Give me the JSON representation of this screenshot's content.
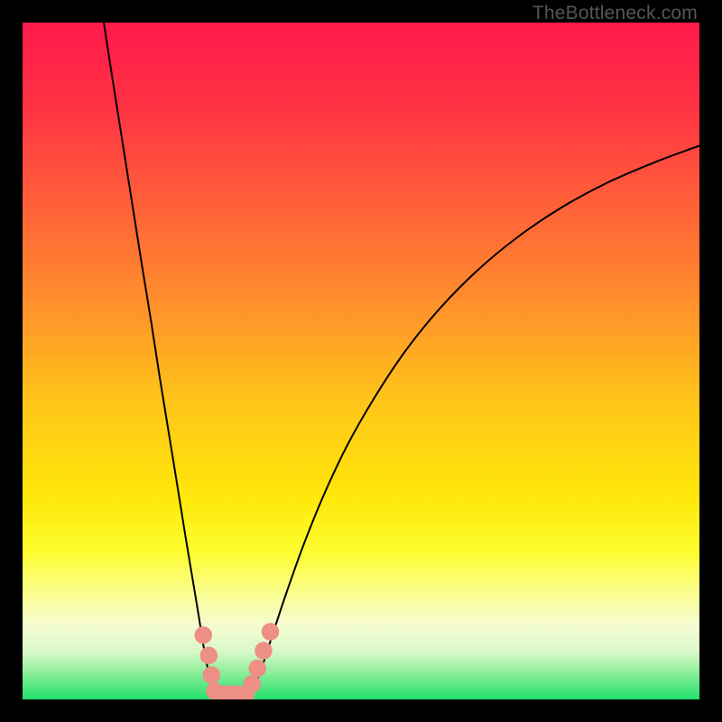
{
  "watermark": "TheBottleneck.com",
  "chart_data": {
    "type": "line",
    "title": "",
    "xlabel": "",
    "ylabel": "",
    "xlim": [
      0,
      100
    ],
    "ylim": [
      0,
      100
    ],
    "background_gradient": {
      "stops": [
        {
          "offset": 0.0,
          "color": "#ff1a4b"
        },
        {
          "offset": 0.12,
          "color": "#ff3144"
        },
        {
          "offset": 0.25,
          "color": "#ff5a3a"
        },
        {
          "offset": 0.4,
          "color": "#ff8a2d"
        },
        {
          "offset": 0.55,
          "color": "#ffc21a"
        },
        {
          "offset": 0.7,
          "color": "#ffe70a"
        },
        {
          "offset": 0.78,
          "color": "#fdfd2d"
        },
        {
          "offset": 0.84,
          "color": "#fbfd8a"
        },
        {
          "offset": 0.89,
          "color": "#f6fcd2"
        },
        {
          "offset": 0.93,
          "color": "#d8f8c8"
        },
        {
          "offset": 0.96,
          "color": "#8dee9a"
        },
        {
          "offset": 1.0,
          "color": "#22e06d"
        }
      ]
    },
    "series": [
      {
        "name": "curve",
        "stroke": "#000000",
        "stroke_width": 2,
        "points": [
          {
            "x": 12.0,
            "y": 100.0
          },
          {
            "x": 13.0,
            "y": 93.5
          },
          {
            "x": 14.5,
            "y": 84.0
          },
          {
            "x": 16.0,
            "y": 74.5
          },
          {
            "x": 17.5,
            "y": 65.0
          },
          {
            "x": 19.0,
            "y": 55.8
          },
          {
            "x": 20.2,
            "y": 48.0
          },
          {
            "x": 21.5,
            "y": 40.0
          },
          {
            "x": 22.8,
            "y": 32.0
          },
          {
            "x": 24.0,
            "y": 24.5
          },
          {
            "x": 25.0,
            "y": 18.5
          },
          {
            "x": 26.0,
            "y": 12.5
          },
          {
            "x": 26.8,
            "y": 7.5
          },
          {
            "x": 27.6,
            "y": 3.5
          },
          {
            "x": 28.4,
            "y": 1.2
          },
          {
            "x": 29.3,
            "y": 0.0
          },
          {
            "x": 30.5,
            "y": 0.0
          },
          {
            "x": 31.7,
            "y": 0.0
          },
          {
            "x": 33.0,
            "y": 0.3
          },
          {
            "x": 34.3,
            "y": 2.2
          },
          {
            "x": 35.5,
            "y": 5.2
          },
          {
            "x": 37.0,
            "y": 9.8
          },
          {
            "x": 39.0,
            "y": 15.8
          },
          {
            "x": 41.5,
            "y": 22.8
          },
          {
            "x": 44.5,
            "y": 30.2
          },
          {
            "x": 48.0,
            "y": 37.6
          },
          {
            "x": 52.0,
            "y": 44.6
          },
          {
            "x": 56.5,
            "y": 51.4
          },
          {
            "x": 61.5,
            "y": 57.6
          },
          {
            "x": 67.0,
            "y": 63.2
          },
          {
            "x": 73.0,
            "y": 68.2
          },
          {
            "x": 79.5,
            "y": 72.6
          },
          {
            "x": 86.5,
            "y": 76.4
          },
          {
            "x": 94.0,
            "y": 79.6
          },
          {
            "x": 100.0,
            "y": 81.8
          }
        ]
      }
    ],
    "markers": {
      "color": "#ed8f84",
      "radius_pct": 1.3,
      "points": [
        {
          "x": 26.7,
          "y": 9.5
        },
        {
          "x": 27.5,
          "y": 6.5
        },
        {
          "x": 27.9,
          "y": 3.6
        },
        {
          "x": 28.4,
          "y": 1.2
        },
        {
          "x": 29.2,
          "y": 0.8
        },
        {
          "x": 30.4,
          "y": 0.8
        },
        {
          "x": 31.6,
          "y": 0.8
        },
        {
          "x": 33.0,
          "y": 0.8
        },
        {
          "x": 33.9,
          "y": 2.3
        },
        {
          "x": 34.7,
          "y": 4.6
        },
        {
          "x": 35.6,
          "y": 7.2
        },
        {
          "x": 36.6,
          "y": 10.0
        }
      ]
    }
  }
}
